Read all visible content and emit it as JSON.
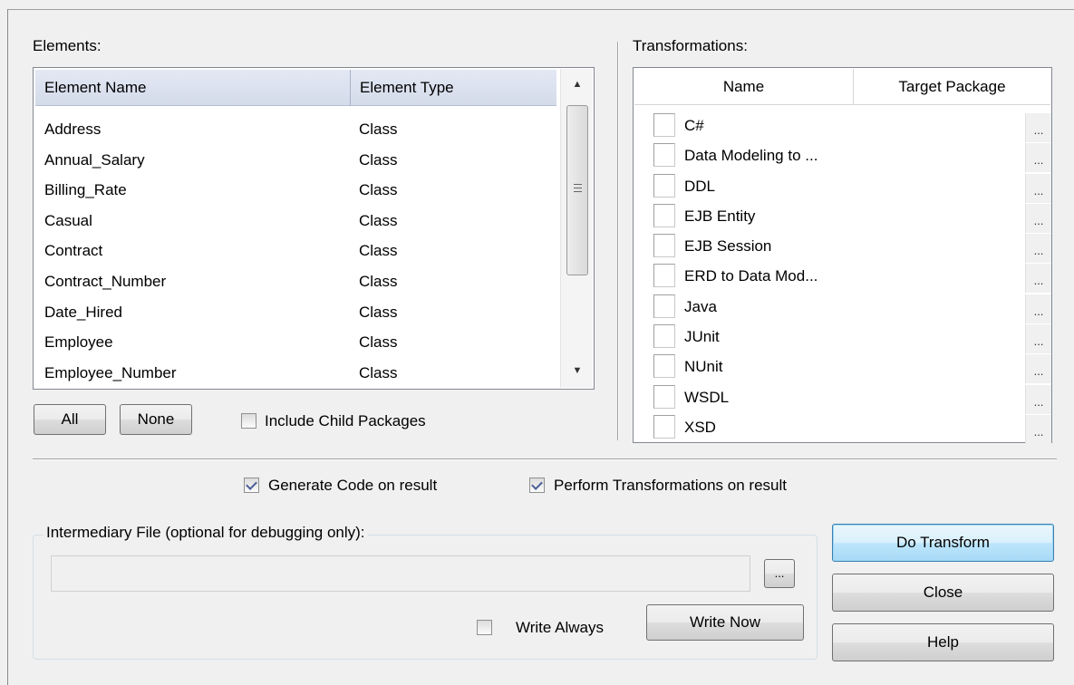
{
  "elements": {
    "label": "Elements:",
    "columns": [
      "Element Name",
      "Element Type"
    ],
    "rows": [
      {
        "name": "Address",
        "type": "Class"
      },
      {
        "name": "Annual_Salary",
        "type": "Class"
      },
      {
        "name": "Billing_Rate",
        "type": "Class"
      },
      {
        "name": "Casual",
        "type": "Class"
      },
      {
        "name": "Contract",
        "type": "Class"
      },
      {
        "name": "Contract_Number",
        "type": "Class"
      },
      {
        "name": "Date_Hired",
        "type": "Class"
      },
      {
        "name": "Employee",
        "type": "Class"
      },
      {
        "name": "Employee_Number",
        "type": "Class"
      }
    ],
    "all_button": "All",
    "none_button": "None",
    "include_child_label": "Include Child Packages",
    "include_child_checked": false
  },
  "transformations": {
    "label": "Transformations:",
    "columns": [
      "Name",
      "Target Package"
    ],
    "dots": "...",
    "rows": [
      {
        "name": "C#",
        "checked": false
      },
      {
        "name": "Data Modeling to ...",
        "checked": false
      },
      {
        "name": "DDL",
        "checked": false
      },
      {
        "name": "EJB Entity",
        "checked": false
      },
      {
        "name": "EJB Session",
        "checked": false
      },
      {
        "name": "ERD to Data Mod...",
        "checked": false
      },
      {
        "name": "Java",
        "checked": false
      },
      {
        "name": "JUnit",
        "checked": false
      },
      {
        "name": "NUnit",
        "checked": false
      },
      {
        "name": "WSDL",
        "checked": false
      },
      {
        "name": "XSD",
        "checked": false
      }
    ]
  },
  "options": {
    "generate_code_label": "Generate Code on result",
    "generate_code_checked": true,
    "perform_transform_label": "Perform Transformations on result",
    "perform_transform_checked": true
  },
  "intermediary": {
    "title": "Intermediary File (optional for debugging only):",
    "value": "",
    "browse_button": "...",
    "write_always_label": "Write Always",
    "write_always_checked": false,
    "write_now_button": "Write Now"
  },
  "actions": {
    "do_transform": "Do Transform",
    "close": "Close",
    "help": "Help"
  }
}
